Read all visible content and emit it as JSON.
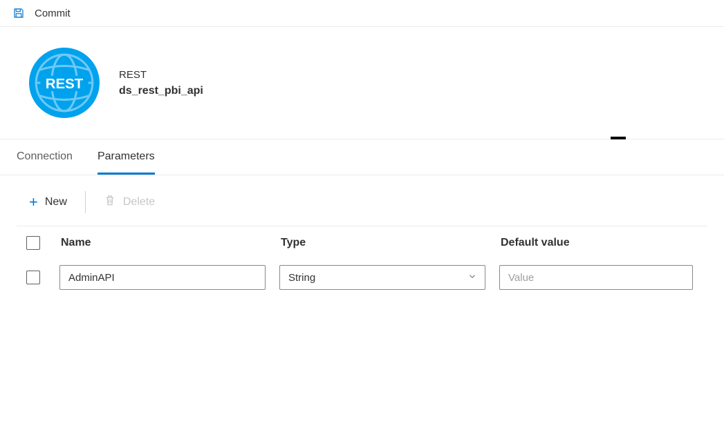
{
  "toolbar_top": {
    "commit_label": "Commit"
  },
  "dataset": {
    "type_label": "REST",
    "name": "ds_rest_pbi_api",
    "badge_text": "REST"
  },
  "tabs": {
    "connection": "Connection",
    "parameters": "Parameters"
  },
  "actions": {
    "new_label": "New",
    "delete_label": "Delete"
  },
  "columns": {
    "name": "Name",
    "type": "Type",
    "default_value": "Default value"
  },
  "rows": [
    {
      "name": "AdminAPI",
      "type": "String",
      "default_value": "",
      "default_value_placeholder": "Value"
    }
  ]
}
